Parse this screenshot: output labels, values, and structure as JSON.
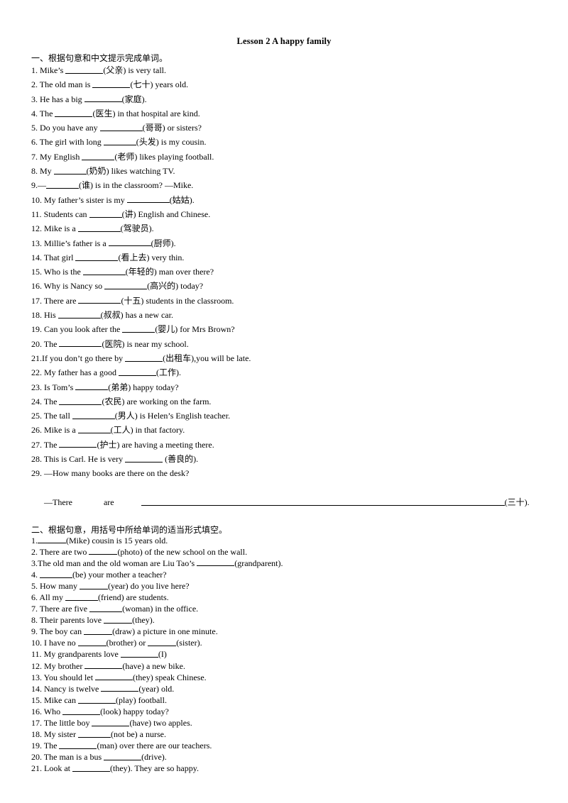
{
  "document": {
    "title": "Lesson 2 A happy family"
  },
  "sections": [
    {
      "id": "section-one",
      "heading": "一、根据句意和中文提示完成单词。",
      "items": [
        {
          "num": "1. ",
          "pre": "Mike’s ",
          "blank": "b-md",
          "post": "(父亲) is very tall."
        },
        {
          "num": "2. ",
          "pre": "The old man is ",
          "blank": "b-md",
          "post": "(七十) years old."
        },
        {
          "num": "3. ",
          "pre": "He has a big ",
          "blank": "b-md",
          "post": "(家庭)."
        },
        {
          "num": "4. ",
          "pre": "The ",
          "blank": "b-md",
          "post": "(医生) in that hospital are kind."
        },
        {
          "num": "5. ",
          "pre": "Do you have any ",
          "blank": "b-lg",
          "post": "(哥哥) or sisters?"
        },
        {
          "num": "6. ",
          "pre": "The girl with long ",
          "blank": "b-sm",
          "post": "(头发) is my cousin."
        },
        {
          "num": "7. ",
          "pre": "My English ",
          "blank": "b-sm",
          "post": "(老师) likes playing football."
        },
        {
          "num": "8. ",
          "pre": "My ",
          "blank": "b-sm",
          "post": "(奶奶) likes watching TV."
        },
        {
          "num": "9.",
          "pre": "—",
          "blank": "b-sm",
          "post": "(谁) is in the classroom? —Mike."
        },
        {
          "num": "10. ",
          "pre": "My father’s sister is my ",
          "blank": "b-lg",
          "post": "(姑姑)."
        },
        {
          "num": "11. ",
          "pre": "Students can ",
          "blank": "b-sm",
          "post": "(讲) English and Chinese."
        },
        {
          "num": "12. ",
          "pre": "Mike is a ",
          "blank": "b-lg",
          "post": "(驾驶员)."
        },
        {
          "num": "13. ",
          "pre": "Millie’s father is a ",
          "blank": "b-lg",
          "post": "(厨师)."
        },
        {
          "num": "14. ",
          "pre": "That girl ",
          "blank": "b-lg",
          "post": "(看上去) very thin."
        },
        {
          "num": "15. ",
          "pre": "Who is the ",
          "blank": "b-lg",
          "post": "(年轻的) man over there?"
        },
        {
          "num": "16. ",
          "pre": "Why is Nancy so ",
          "blank": "b-lg",
          "post": "(高兴的) today?"
        },
        {
          "num": "17. ",
          "pre": "There are ",
          "blank": "b-lg",
          "post": "(十五) students in the classroom."
        },
        {
          "num": "18. ",
          "pre": "His ",
          "blank": "b-lg",
          "post": "(叔叔) has a new car."
        },
        {
          "num": "19. ",
          "pre": "Can you look after the ",
          "blank": "b-sm",
          "post": "(婴儿) for Mrs Brown?"
        },
        {
          "num": "20. ",
          "pre": "The ",
          "blank": "b-lg",
          "post": "(医院) is near my school."
        },
        {
          "num": "21.",
          "pre": "If you don’t go there by ",
          "blank": "b-md",
          "post": "(出租车),you will be late."
        },
        {
          "num": "22. ",
          "pre": "My father has a good ",
          "blank": "b-md",
          "post": "(工作)."
        },
        {
          "num": "23. ",
          "pre": "Is Tom’s ",
          "blank": "b-sm",
          "post": "(弟弟) happy today?"
        },
        {
          "num": "24. ",
          "pre": "The ",
          "blank": "b-lg",
          "post": "(农民) are working on the farm."
        },
        {
          "num": "25. ",
          "pre": "The tall ",
          "blank": "b-lg",
          "post": "(男人) is Helen’s English teacher."
        },
        {
          "num": "26. ",
          "pre": "Mike is a ",
          "blank": "b-sm",
          "post": "(工人) in that factory."
        },
        {
          "num": "27. ",
          "pre": "The ",
          "blank": "b-md",
          "post": "(护士) are having a meeting there."
        },
        {
          "num": "28. ",
          "pre": "This is Carl. He is very ",
          "blank": "b-md",
          "post": " (善良的)."
        },
        {
          "num": "29. ",
          "pre": "—How many books are there on the desk?",
          "blank": "",
          "post": ""
        }
      ],
      "answer_line": {
        "pre": "—There",
        "mid": "are",
        "post": "(三十)."
      }
    },
    {
      "id": "section-two",
      "heading": "二、根据句意，用括号中所给单词的适当形式填空。",
      "items": [
        {
          "num": "1.",
          "pre": "",
          "blank": "b-xs",
          "post": "(Mike) cousin is 15 years old."
        },
        {
          "num": "2. ",
          "pre": "There are two ",
          "blank": "b-xs",
          "post": "(photo) of the new school on the wall."
        },
        {
          "num": "3.",
          "pre": "The old man and the old woman are Liu Tao’s ",
          "blank": "b-md",
          "post": "(grandparent)."
        },
        {
          "num": "4. ",
          "pre": "",
          "blank": "b-sm",
          "post": "(be) your mother a teacher?"
        },
        {
          "num": "5. ",
          "pre": "How many ",
          "blank": "b-xs",
          "post": "(year) do you live here?"
        },
        {
          "num": "6. ",
          "pre": "All my ",
          "blank": "b-sm",
          "post": "(friend) are students."
        },
        {
          "num": "7. ",
          "pre": "There are five ",
          "blank": "b-sm",
          "post": "(woman) in the office."
        },
        {
          "num": "8. ",
          "pre": "Their parents love ",
          "blank": "b-xs",
          "post": "(they)."
        },
        {
          "num": "9. ",
          "pre": "The boy can ",
          "blank": "b-xs",
          "post": "(draw) a picture in one minute."
        },
        {
          "num": "10. ",
          "pre": "I have no ",
          "blank": "b-xs",
          "post": "(brother) or ",
          "blank2": "b-xs",
          "post2": "(sister)."
        },
        {
          "num": "11. ",
          "pre": "My grandparents love ",
          "blank": "b-md",
          "post": "(I)"
        },
        {
          "num": "12. ",
          "pre": "My brother ",
          "blank": "b-md",
          "post": "(have) a new bike."
        },
        {
          "num": "13. ",
          "pre": "You should let ",
          "blank": "b-md",
          "post": "(they) speak Chinese."
        },
        {
          "num": "14. ",
          "pre": "Nancy is twelve ",
          "blank": "b-md",
          "post": "(year) old."
        },
        {
          "num": "15. ",
          "pre": "Mike can ",
          "blank": "b-md",
          "post": "(play) football."
        },
        {
          "num": "16. ",
          "pre": "Who ",
          "blank": "b-md",
          "post": "(look) happy today?"
        },
        {
          "num": "17. ",
          "pre": "The little boy ",
          "blank": "b-md",
          "post": "(have) two apples."
        },
        {
          "num": "18. ",
          "pre": "My sister ",
          "blank": "b-sm",
          "post": "(not be) a nurse."
        },
        {
          "num": "19. ",
          "pre": "The ",
          "blank": "b-md",
          "post": "(man) over there are our teachers."
        },
        {
          "num": "20. ",
          "pre": "The man is a bus ",
          "blank": "b-md",
          "post": "(drive)."
        },
        {
          "num": "21. ",
          "pre": "Look at ",
          "blank": "b-md",
          "post": "(they). They are so happy."
        }
      ]
    }
  ]
}
